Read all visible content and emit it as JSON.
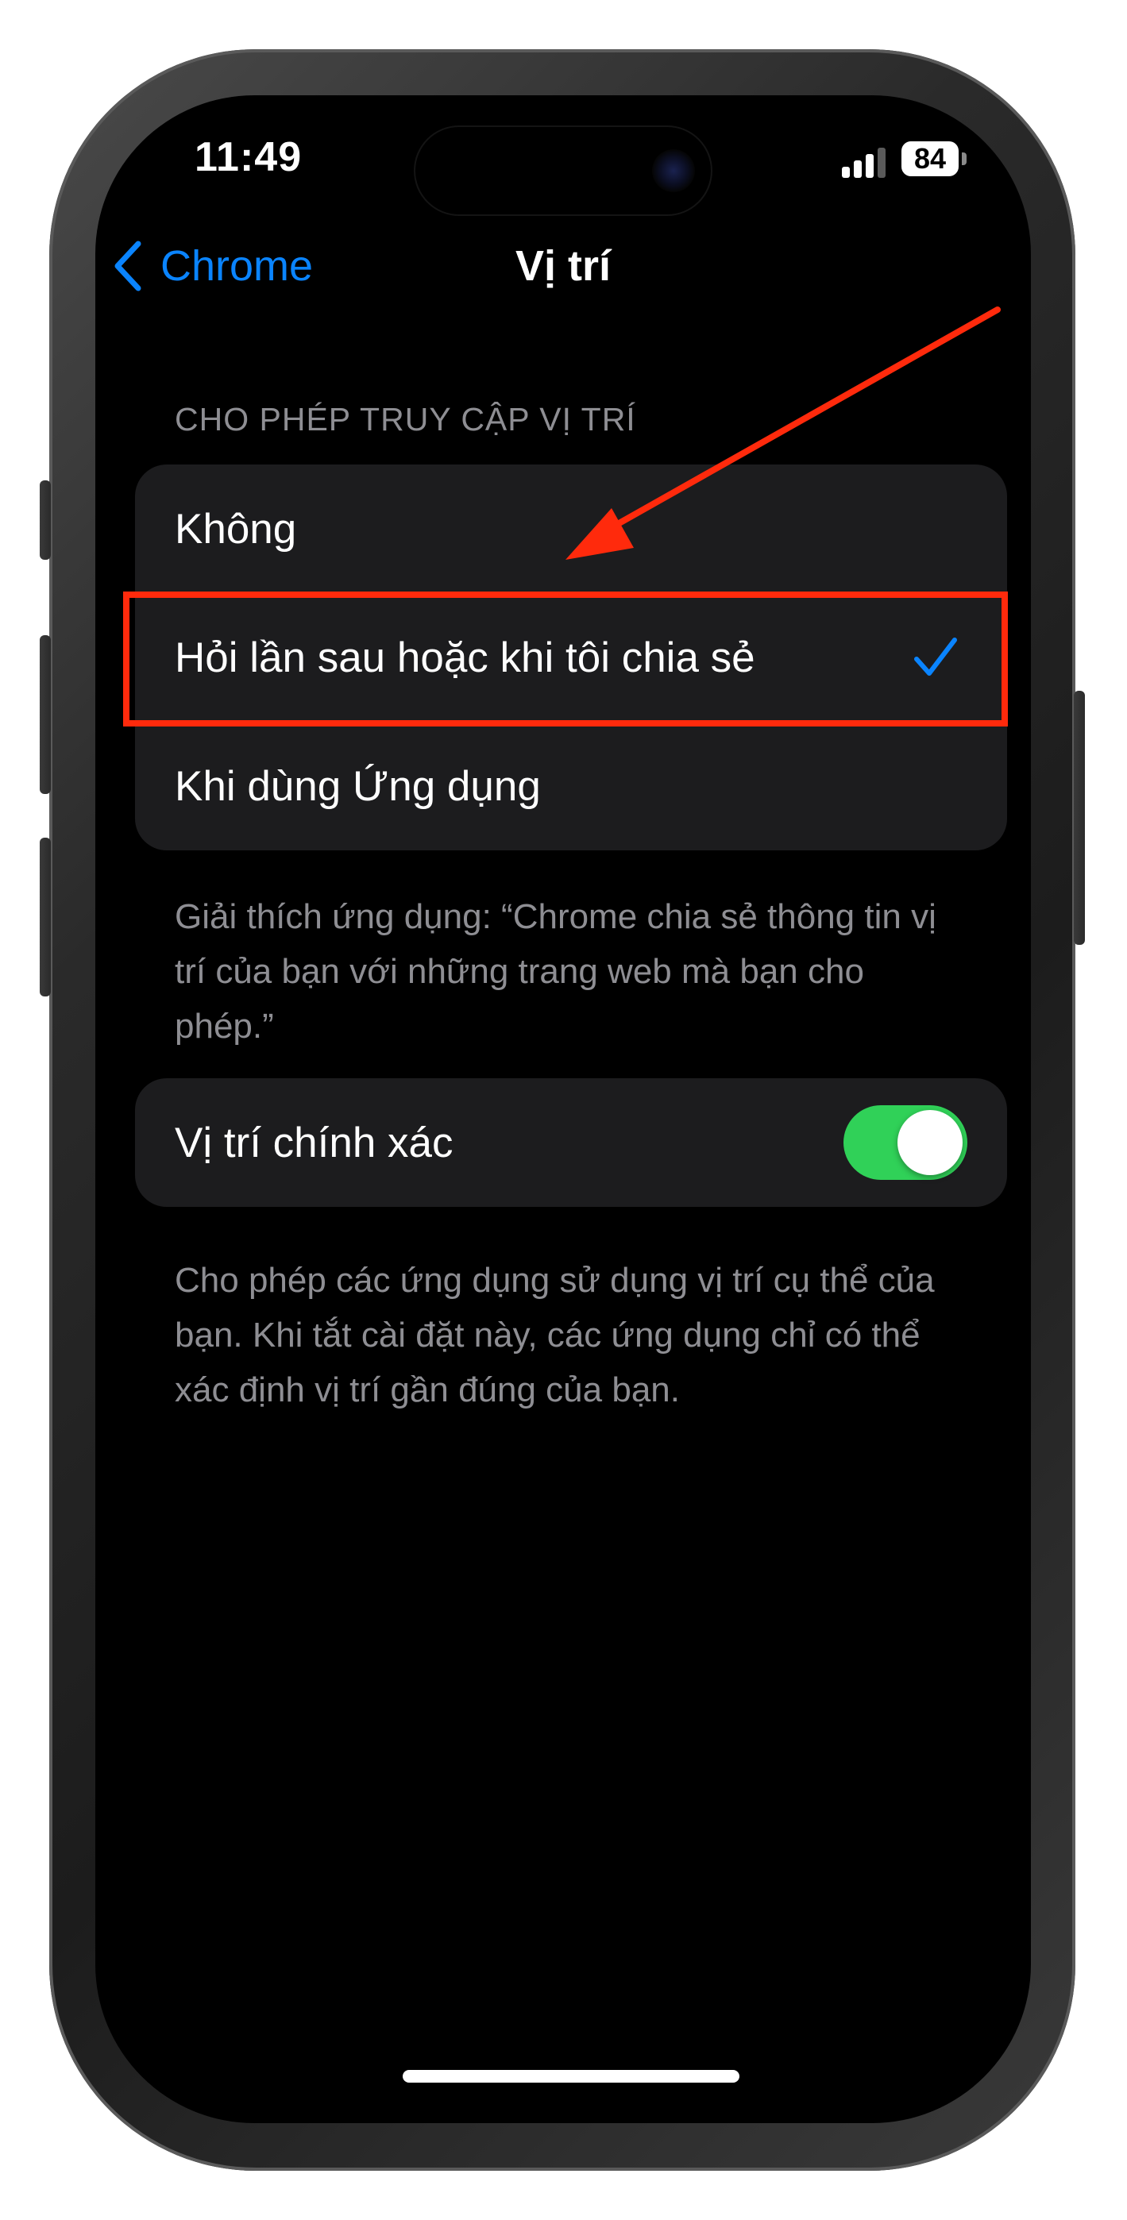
{
  "status_bar": {
    "time": "11:49",
    "battery": "84"
  },
  "nav": {
    "back_label": "Chrome",
    "title": "Vị trí"
  },
  "location_access": {
    "header": "CHO PHÉP TRUY CẬP VỊ TRÍ",
    "options": [
      {
        "label": "Không",
        "selected": false
      },
      {
        "label": "Hỏi lần sau hoặc khi tôi chia sẻ",
        "selected": true
      },
      {
        "label": "Khi dùng Ứng dụng",
        "selected": false
      }
    ],
    "footer": "Giải thích ứng dụng: “Chrome chia sẻ thông tin vị trí của bạn với những trang web mà bạn cho phép.”"
  },
  "precise_location": {
    "label": "Vị trí chính xác",
    "enabled": true,
    "footer": "Cho phép các ứng dụng sử dụng vị trí cụ thể của bạn. Khi tắt cài đặt này, các ứng dụng chỉ có thể xác định vị trí gần đúng của bạn."
  },
  "colors": {
    "accent": "#0a84ff",
    "toggle_on": "#30d158",
    "annotation": "#ff2a0c",
    "cell_background": "#1c1c1e"
  },
  "icons": {
    "back": "chevron-left-icon",
    "selected": "checkmark-icon",
    "annotation": "red-arrow-icon"
  }
}
